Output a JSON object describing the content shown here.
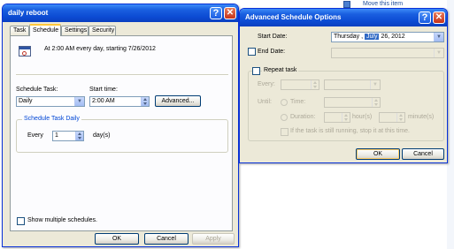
{
  "background": {
    "link_text": "Move this item"
  },
  "dialog_main": {
    "title": "daily reboot",
    "help_glyph": "?",
    "close_glyph": "✕",
    "tabs": [
      {
        "label": "Task"
      },
      {
        "label": "Schedule"
      },
      {
        "label": "Settings"
      },
      {
        "label": "Security"
      }
    ],
    "summary_text": "At 2:00 AM every day, starting 7/26/2012",
    "schedule_task_label": "Schedule Task:",
    "schedule_task_value": "Daily",
    "start_time_label": "Start time:",
    "start_time_value": "2:00 AM",
    "advanced_button": "Advanced...",
    "group_title": "Schedule Task Daily",
    "every_label": "Every",
    "every_value": "1",
    "every_unit": "day(s)",
    "show_multiple_label": "Show multiple schedules.",
    "ok_button": "OK",
    "cancel_button": "Cancel",
    "apply_button": "Apply"
  },
  "dialog_advanced": {
    "title": "Advanced Schedule Options",
    "help_glyph": "?",
    "close_glyph": "✕",
    "start_date_label": "Start Date:",
    "start_date_weekday": "Thursday ,",
    "start_date_month": "July",
    "start_date_day_year": "26, 2012",
    "end_date_label": "End Date:",
    "repeat_task_label": "Repeat task",
    "every_label": "Every:",
    "until_label": "Until:",
    "time_label": "Time:",
    "duration_label": "Duration:",
    "hours_label": "hour(s)",
    "minutes_label": "minute(s)",
    "still_running_label": "If the task is still running, stop it at this time.",
    "ok_button": "OK",
    "cancel_button": "Cancel"
  },
  "colors": {
    "titlebar_blue": "#0c4bd3",
    "dialog_face": "#ece9d8",
    "group_title_blue": "#0046d5",
    "selection_blue": "#316ac5"
  }
}
